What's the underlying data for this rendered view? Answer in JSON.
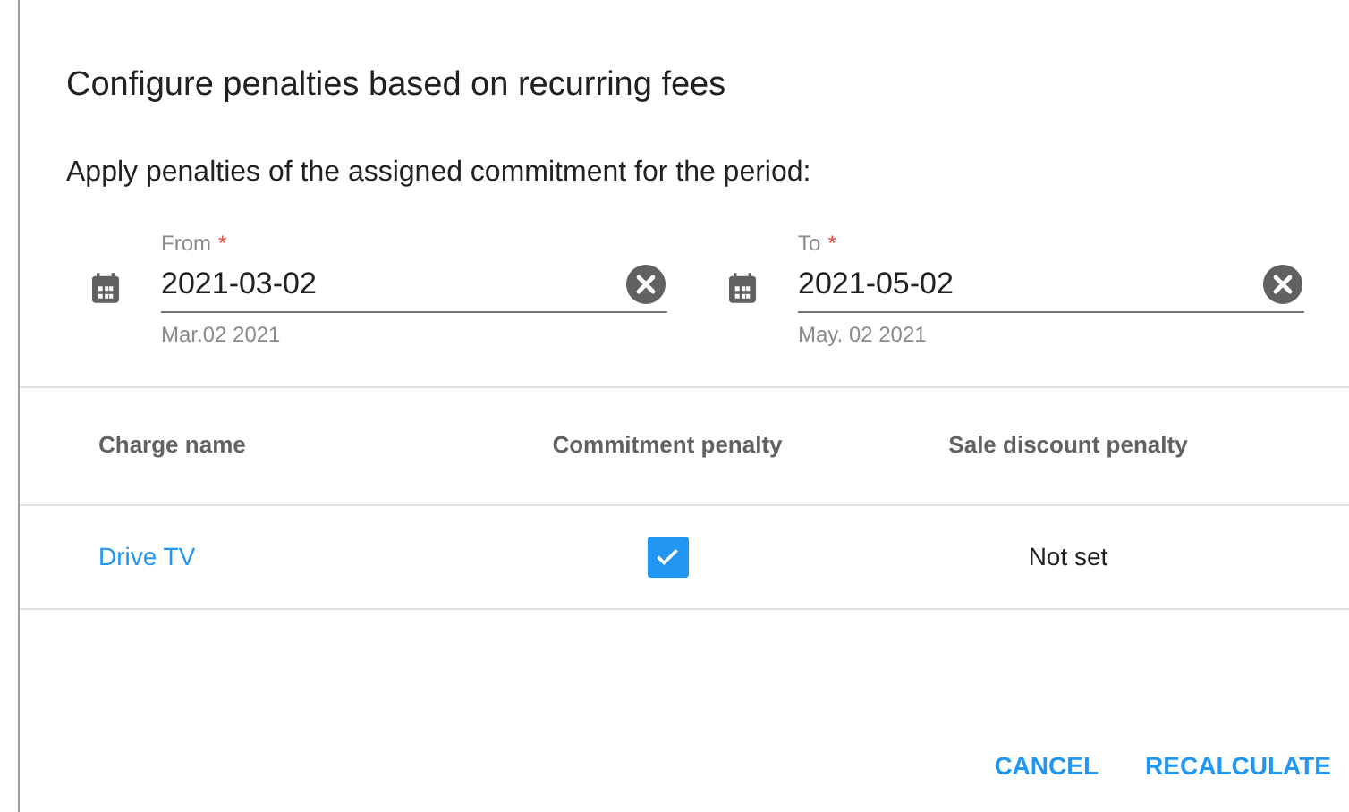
{
  "dialog": {
    "title": "Configure penalties based on recurring fees",
    "description": "Apply penalties of the assigned commitment for the period:"
  },
  "date_fields": [
    {
      "label": "From",
      "required_mark": "*",
      "value": "2021-03-02",
      "hint": "Mar.02 2021"
    },
    {
      "label": "To",
      "required_mark": "*",
      "value": "2021-05-02",
      "hint": "May. 02 2021"
    }
  ],
  "table": {
    "columns": [
      "Charge name",
      "Commitment penalty",
      "Sale discount penalty"
    ],
    "rows": [
      {
        "charge_name": "Drive TV",
        "commitment_penalty_checked": true,
        "sale_discount_penalty": "Not set"
      }
    ]
  },
  "buttons": [
    "CANCEL",
    "RECALCULATE"
  ]
}
